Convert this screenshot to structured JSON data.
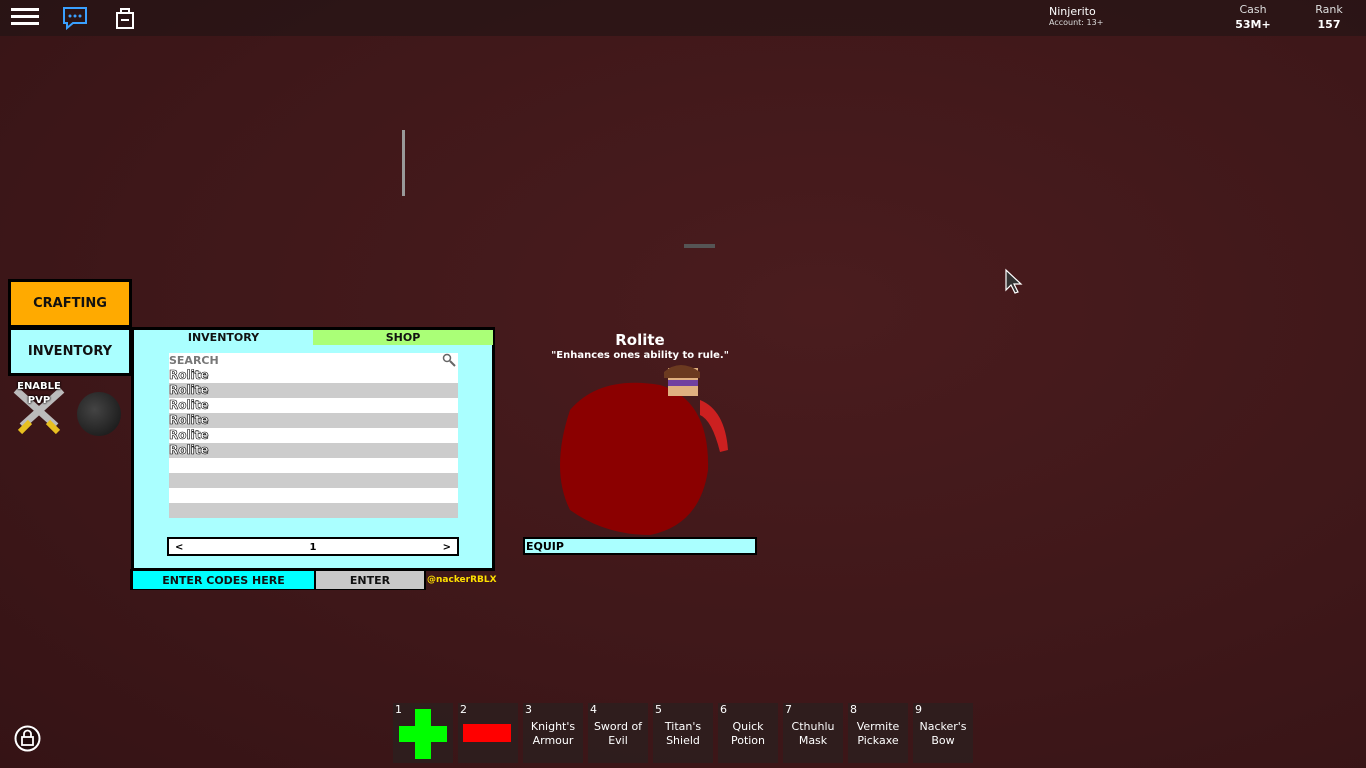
{
  "topbar": {
    "menu_icon": "hamburger-icon",
    "chat_icon": "chat-icon",
    "backpack_icon": "backpack-icon",
    "username": "Ninjerito",
    "account": "Account: 13+",
    "cash_label": "Cash",
    "cash_value": "53M+",
    "rank_label": "Rank",
    "rank_value": "157"
  },
  "sidebar": {
    "crafting": "CRAFTING",
    "inventory": "INVENTORY",
    "pvp_label": "ENABLE PVP",
    "crafting_color": "#ffaa00",
    "inventory_color": "#aaffff"
  },
  "panel": {
    "tabs": [
      {
        "label": "INVENTORY",
        "active": true
      },
      {
        "label": "SHOP",
        "color": "#aaff77"
      }
    ],
    "search_placeholder": "SEARCH",
    "items": [
      "Rolite",
      "Rolite",
      "Rolite",
      "Rolite",
      "Rolite",
      "Rolite",
      "",
      "",
      "",
      "",
      ""
    ],
    "pager": {
      "prev": "<",
      "page": "1",
      "next": ">"
    },
    "code_placeholder": "ENTER CODES HERE",
    "enter": "ENTER",
    "credit": "@nackerRBLX"
  },
  "preview": {
    "name": "Rolite",
    "description": "\"Enhances ones ability to rule.\"",
    "equip": "EQUIP"
  },
  "hotbar": [
    {
      "num": "1",
      "label": "",
      "icon": "green-plus-icon"
    },
    {
      "num": "2",
      "label": "",
      "icon": "red-bar-icon"
    },
    {
      "num": "3",
      "label": "Knight's Armour"
    },
    {
      "num": "4",
      "label": "Sword of Evil"
    },
    {
      "num": "5",
      "label": "Titan's Shield"
    },
    {
      "num": "6",
      "label": "Quick Potion"
    },
    {
      "num": "7",
      "label": "Cthuhlu Mask"
    },
    {
      "num": "8",
      "label": "Vermite Pickaxe"
    },
    {
      "num": "9",
      "label": "Nacker's Bow"
    }
  ]
}
